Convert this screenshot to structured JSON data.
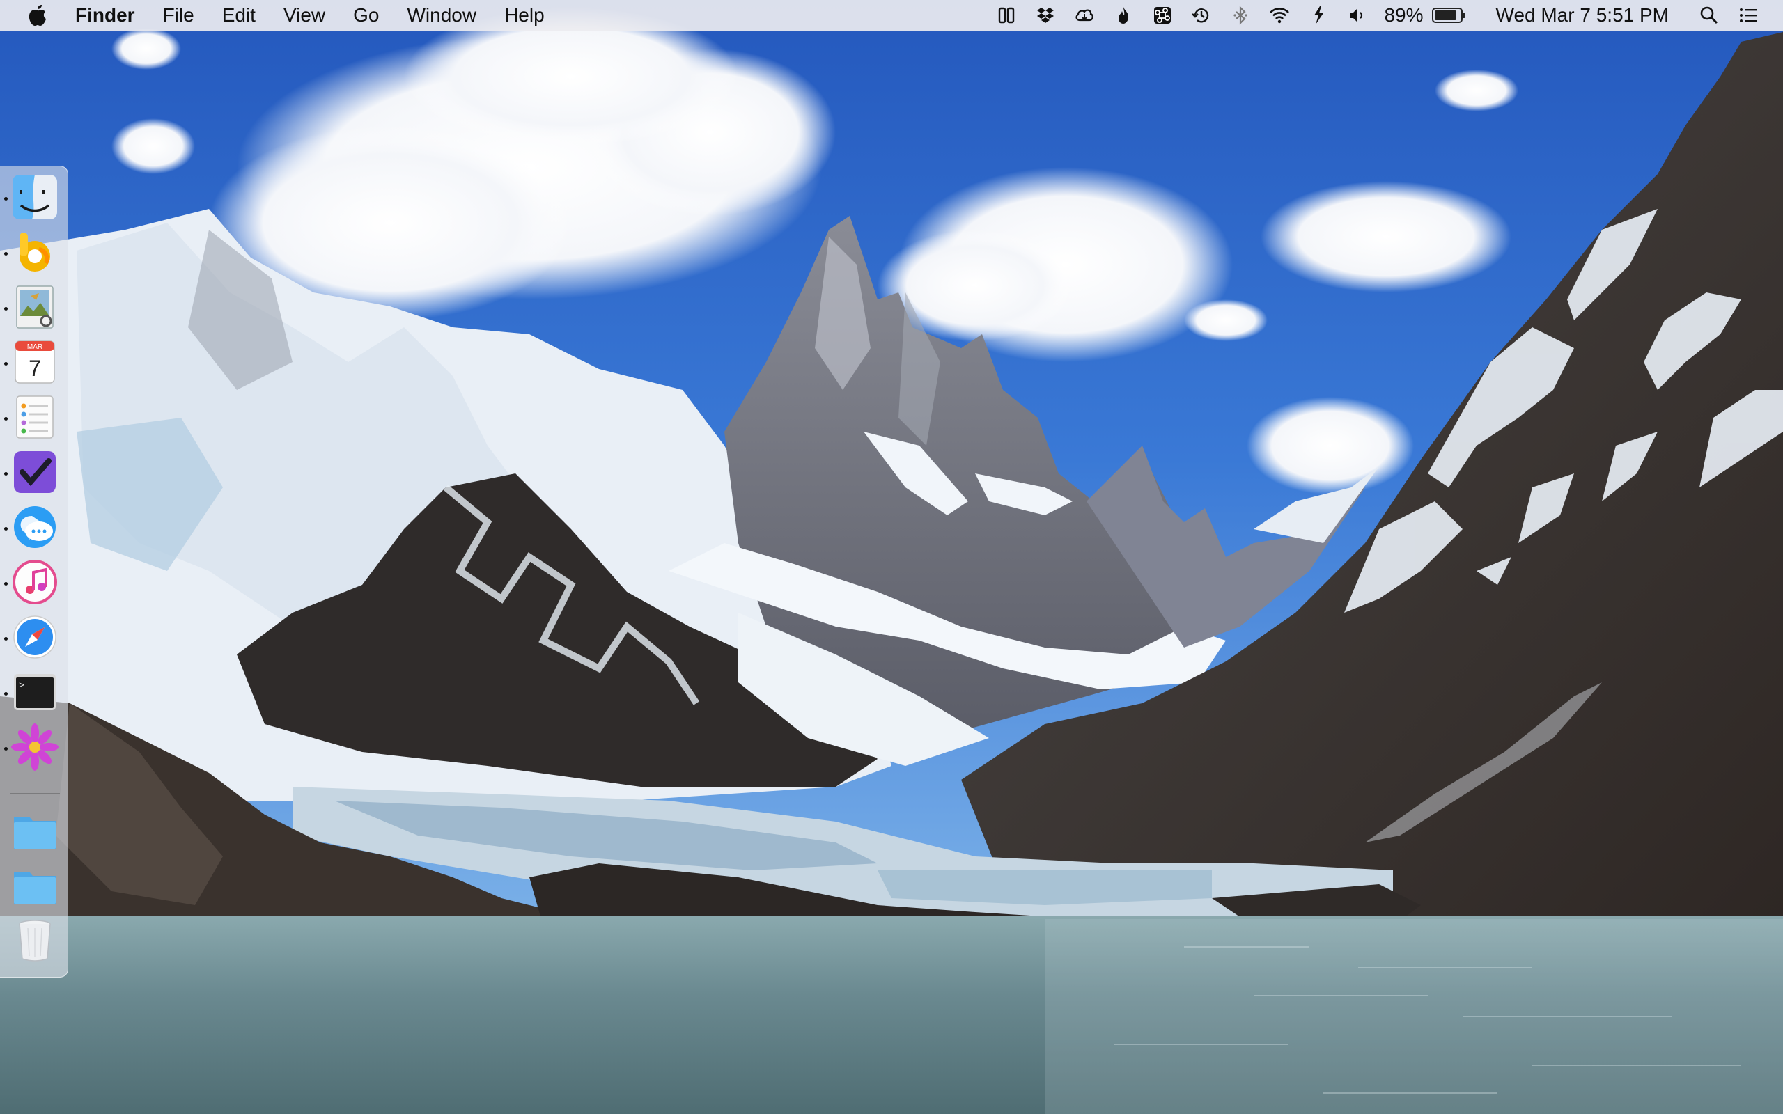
{
  "menubar": {
    "app_name": "Finder",
    "menus": [
      "File",
      "Edit",
      "View",
      "Go",
      "Window",
      "Help"
    ],
    "battery_percent": "89%",
    "battery_level": 0.89,
    "clock": "Wed Mar 7  5:51 PM",
    "status_icons": [
      "sidebar-columns-icon",
      "dropbox-icon",
      "creative-cloud-icon",
      "flame-icon",
      "command-key-icon",
      "time-machine-icon",
      "bluetooth-icon",
      "wifi-icon",
      "grab-icon",
      "volume-icon",
      "battery-icon",
      "spotlight-search-icon",
      "notification-center-icon"
    ]
  },
  "dock": {
    "items": [
      {
        "name": "Finder",
        "icon": "finder-icon",
        "running": true
      },
      {
        "name": "Bing / App",
        "icon": "bing-app-icon",
        "running": true
      },
      {
        "name": "Preview",
        "icon": "preview-icon",
        "running": true
      },
      {
        "name": "Calendar",
        "icon": "calendar-icon",
        "running": true,
        "month": "MAR",
        "day": "7"
      },
      {
        "name": "Reminders",
        "icon": "reminders-icon",
        "running": true
      },
      {
        "name": "OmniFocus",
        "icon": "checkmark-app-icon",
        "running": true
      },
      {
        "name": "Messages",
        "icon": "messages-icon",
        "running": true
      },
      {
        "name": "iTunes",
        "icon": "itunes-icon",
        "running": true
      },
      {
        "name": "Safari",
        "icon": "safari-icon",
        "running": true
      },
      {
        "name": "Terminal",
        "icon": "terminal-icon",
        "running": true,
        "prompt": ">_"
      },
      {
        "name": "Flower App",
        "icon": "flower-icon",
        "running": true
      },
      {
        "name": "Folder",
        "icon": "folder-icon",
        "running": false
      },
      {
        "name": "Folder",
        "icon": "folder-icon",
        "running": false
      },
      {
        "name": "Trash",
        "icon": "trash-icon",
        "running": false
      }
    ]
  },
  "colors": {
    "sky_top": "#2a66c9",
    "sky_bottom": "#5d95e0",
    "water": "#5e7f86",
    "rock": "#3b3430",
    "snow": "#eef3f8"
  }
}
